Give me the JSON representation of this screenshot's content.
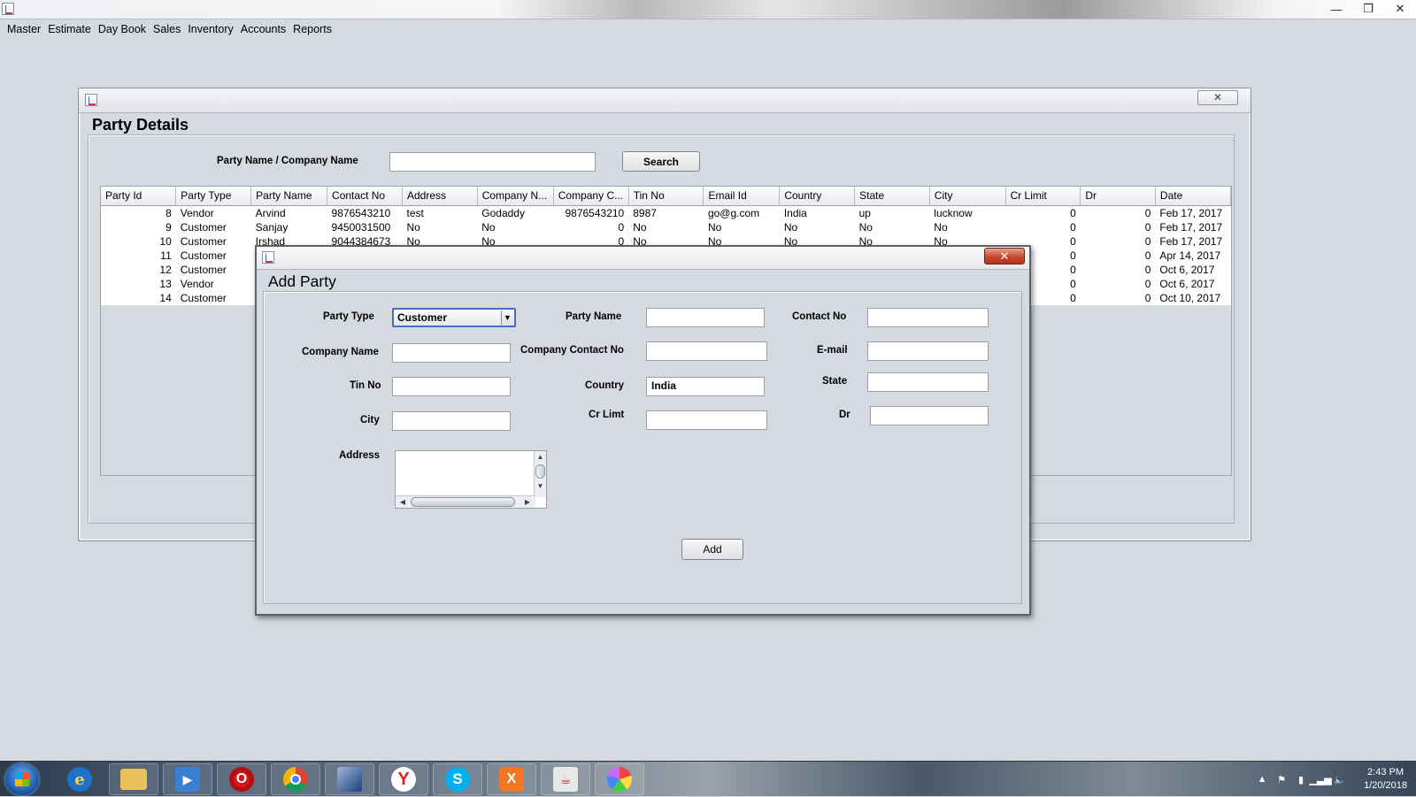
{
  "menu": [
    "Master",
    "Estimate",
    "Day Book",
    "Sales",
    "Inventory",
    "Accounts",
    "Reports"
  ],
  "window_controls": {
    "minimize": "—",
    "restore": "❐",
    "close": "✕"
  },
  "party_details": {
    "title": "Party Details",
    "close_glyph": "✕",
    "search_label": "Party Name  / Company Name",
    "search_value": "",
    "search_button": "Search",
    "columns": [
      "Party Id",
      "Party Type",
      "Party Name",
      "Contact No",
      "Address",
      "Company N...",
      "Company C...",
      "Tin No",
      "Email Id",
      "Country",
      "State",
      "City",
      "Cr Limit",
      "Dr",
      "Date"
    ],
    "rows": [
      {
        "id": "8",
        "type": "Vendor",
        "name": "Arvind",
        "contact": "9876543210",
        "address": "test",
        "company_name": "Godaddy",
        "company_contact": "9876543210",
        "tin": "8987",
        "email": "go@g.com",
        "country": "India",
        "state": "up",
        "city": "lucknow",
        "cr_limit": "0",
        "dr": "0",
        "date": "Feb 17, 2017"
      },
      {
        "id": "9",
        "type": "Customer",
        "name": "Sanjay",
        "contact": "9450031500",
        "address": "No",
        "company_name": "No",
        "company_contact": "0",
        "tin": "No",
        "email": "No",
        "country": "No",
        "state": "No",
        "city": "No",
        "cr_limit": "0",
        "dr": "0",
        "date": "Feb 17, 2017"
      },
      {
        "id": "10",
        "type": "Customer",
        "name": "Irshad",
        "contact": "9044384673",
        "address": "No",
        "company_name": "No",
        "company_contact": "0",
        "tin": "No",
        "email": "No",
        "country": "No",
        "state": "No",
        "city": "No",
        "cr_limit": "0",
        "dr": "0",
        "date": "Feb 17, 2017"
      },
      {
        "id": "11",
        "type": "Customer",
        "name": "",
        "contact": "",
        "address": "",
        "company_name": "",
        "company_contact": "",
        "tin": "",
        "email": "",
        "country": "",
        "state": "",
        "city": "",
        "cr_limit": "0",
        "dr": "0",
        "date": "Apr 14, 2017"
      },
      {
        "id": "12",
        "type": "Customer",
        "name": "",
        "contact": "",
        "address": "",
        "company_name": "",
        "company_contact": "",
        "tin": "",
        "email": "",
        "country": "",
        "state": "",
        "city": "",
        "cr_limit": "0",
        "dr": "0",
        "date": "Oct 6, 2017"
      },
      {
        "id": "13",
        "type": "Vendor",
        "name": "",
        "contact": "",
        "address": "",
        "company_name": "",
        "company_contact": "",
        "tin": "",
        "email": "",
        "country": "",
        "state": "",
        "city": "",
        "cr_limit": "0",
        "dr": "0",
        "date": "Oct 6, 2017"
      },
      {
        "id": "14",
        "type": "Customer",
        "name": "",
        "contact": "",
        "address": "",
        "company_name": "",
        "company_contact": "",
        "tin": "",
        "email": "",
        "country": "",
        "state": "",
        "city": "",
        "cr_limit": "0",
        "dr": "0",
        "date": "Oct 10, 2017"
      }
    ]
  },
  "add_party": {
    "title": "Add Party",
    "close_glyph": "✕",
    "labels": {
      "party_type": "Party Type",
      "party_name": "Party Name",
      "contact_no": "Contact No",
      "company_name": "Company Name",
      "company_contact_no": "Company Contact No",
      "email": "E-mail",
      "tin_no": "Tin No",
      "country": "Country",
      "state": "State",
      "city": "City",
      "cr_limit": "Cr Limt",
      "dr": "Dr",
      "address": "Address"
    },
    "values": {
      "party_type": "Customer",
      "party_name": "",
      "contact_no": "",
      "company_name": "",
      "company_contact_no": "",
      "email": "",
      "tin_no": "",
      "country": "India",
      "state": "",
      "city": "",
      "cr_limit": "",
      "dr": "",
      "address": ""
    },
    "add_button": "Add"
  },
  "taskbar": {
    "apps": [
      "internet-explorer",
      "file-explorer",
      "media-player",
      "opera",
      "chrome",
      "virtualbox",
      "yandex",
      "skype",
      "xampp",
      "java",
      "paint"
    ],
    "clock_time": "2:43 PM",
    "clock_date": "1/20/2018"
  }
}
